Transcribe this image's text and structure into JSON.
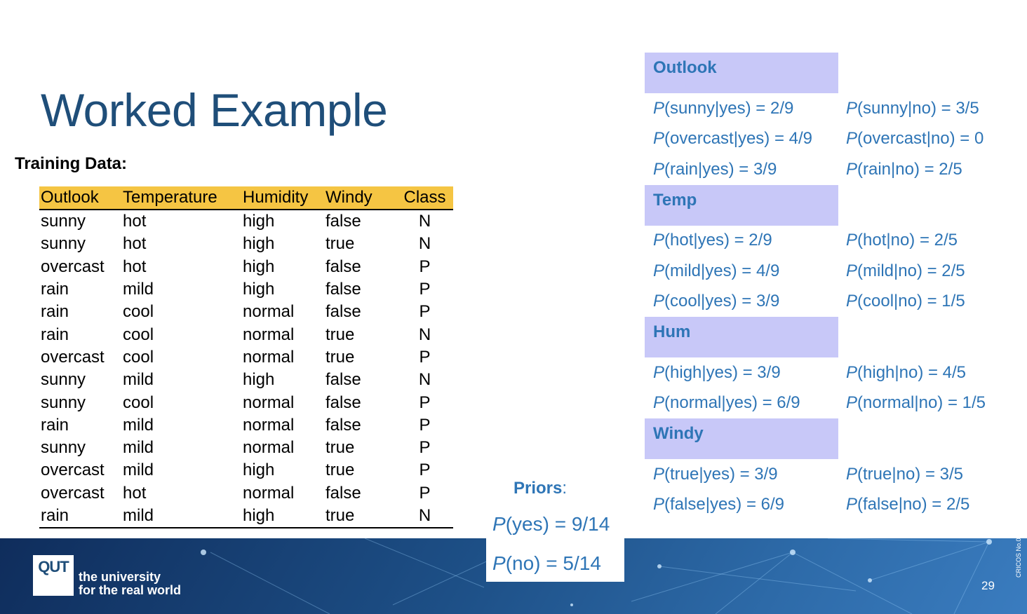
{
  "slide": {
    "title": "Worked Example",
    "subtitle": "Training Data:",
    "page_number": "29",
    "cricos": "CRICOS No.00213J"
  },
  "training_table": {
    "headers": [
      "Outlook",
      "Temperature",
      "Humidity",
      "Windy",
      "Class"
    ],
    "rows": [
      [
        "sunny",
        "hot",
        "high",
        "false",
        "N"
      ],
      [
        "sunny",
        "hot",
        "high",
        "true",
        "N"
      ],
      [
        "overcast",
        "hot",
        "high",
        "false",
        "P"
      ],
      [
        "rain",
        "mild",
        "high",
        "false",
        "P"
      ],
      [
        "rain",
        "cool",
        "normal",
        "false",
        "P"
      ],
      [
        "rain",
        "cool",
        "normal",
        "true",
        "N"
      ],
      [
        "overcast",
        "cool",
        "normal",
        "true",
        "P"
      ],
      [
        "sunny",
        "mild",
        "high",
        "false",
        "N"
      ],
      [
        "sunny",
        "cool",
        "normal",
        "false",
        "P"
      ],
      [
        "rain",
        "mild",
        "normal",
        "false",
        "P"
      ],
      [
        "sunny",
        "mild",
        "normal",
        "true",
        "P"
      ],
      [
        "overcast",
        "mild",
        "high",
        "true",
        "P"
      ],
      [
        "overcast",
        "hot",
        "normal",
        "false",
        "P"
      ],
      [
        "rain",
        "mild",
        "high",
        "true",
        "N"
      ]
    ]
  },
  "probabilities": {
    "groups": [
      {
        "title": "Outlook",
        "rows": [
          {
            "left": "(sunny|yes) = 2/9",
            "right": "(sunny|no) = 3/5"
          },
          {
            "left": "(overcast|yes) = 4/9",
            "right": "(overcast|no) = 0"
          },
          {
            "left": "(rain|yes) = 3/9",
            "right": "(rain|no) = 2/5"
          }
        ]
      },
      {
        "title": "Temp",
        "rows": [
          {
            "left": "(hot|yes) = 2/9",
            "right": "(hot|no) = 2/5"
          },
          {
            "left": "(mild|yes) = 4/9",
            "right": "(mild|no) = 2/5"
          },
          {
            "left": "(cool|yes) = 3/9",
            "right": "(cool|no) = 1/5"
          }
        ]
      },
      {
        "title": "Hum",
        "rows": [
          {
            "left": "(high|yes) = 3/9",
            "right": "(high|no) = 4/5"
          },
          {
            "left": "(normal|yes) = 6/9",
            "right": "(normal|no) = 1/5"
          }
        ]
      },
      {
        "title": "Windy",
        "rows": [
          {
            "left": "(true|yes) = 3/9",
            "right": "(true|no) = 3/5"
          },
          {
            "left": "(false|yes) = 6/9",
            "right": "(false|no) = 2/5"
          }
        ]
      }
    ]
  },
  "priors": {
    "title": "Priors",
    "colon": ":",
    "yes": "(yes) = 9/14",
    "no": "(no) = 5/14"
  },
  "p_symbol": "P",
  "branding": {
    "logo_text": "QUT",
    "tagline_line1": "the university",
    "tagline_line2": "for the real world"
  },
  "colors": {
    "title": "#1f4e79",
    "prob_text": "#2e75b6",
    "table_header": "#f5c543",
    "group_header": "#c8c8f8",
    "footer": "#1d4f86"
  }
}
